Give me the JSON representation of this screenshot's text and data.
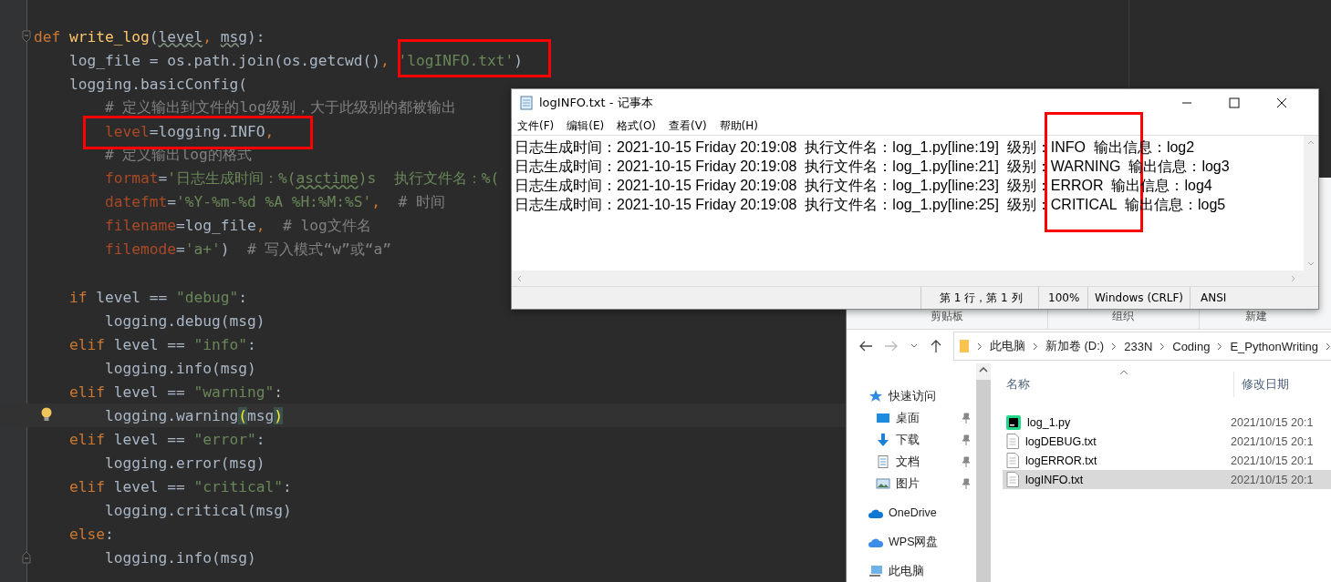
{
  "editor": {
    "lines": [
      {
        "fold_start": true,
        "fold_end": false,
        "current": false,
        "hint": false,
        "spans": [
          {
            "text": "def ",
            "kind": "kw"
          },
          {
            "text": "write_log",
            "kind": "fn"
          },
          {
            "text": "(",
            "kind": "plain"
          },
          {
            "text": "level",
            "kind": "typo"
          },
          {
            "text": ", ",
            "kind": "kw"
          },
          {
            "text": "msg",
            "kind": "typo"
          },
          {
            "text": "):",
            "kind": "plain"
          }
        ]
      },
      {
        "fold_start": false,
        "fold_end": false,
        "current": false,
        "hint": false,
        "spans": [
          {
            "text": "    log_file = os.path.join(os.getcwd()",
            "kind": "plain"
          },
          {
            "text": ", ",
            "kind": "kw"
          },
          {
            "text": "'logINFO.txt'",
            "kind": "str"
          },
          {
            "text": ")",
            "kind": "plain"
          }
        ]
      },
      {
        "fold_start": false,
        "fold_end": false,
        "current": false,
        "hint": false,
        "spans": [
          {
            "text": "    logging.basicConfig(",
            "kind": "plain"
          }
        ]
      },
      {
        "fold_start": false,
        "fold_end": false,
        "current": false,
        "hint": false,
        "spans": [
          {
            "text": "        # 定义输出到文件的log级别，大于此级别的都被输出",
            "kind": "comment"
          }
        ]
      },
      {
        "fold_start": false,
        "fold_end": false,
        "current": false,
        "hint": false,
        "spans": [
          {
            "text": "        level",
            "kind": "param"
          },
          {
            "text": "=logging.INFO",
            "kind": "plain"
          },
          {
            "text": ",",
            "kind": "kw"
          }
        ]
      },
      {
        "fold_start": false,
        "fold_end": false,
        "current": false,
        "hint": false,
        "spans": [
          {
            "text": "        # 定义输出log的格式",
            "kind": "comment"
          }
        ]
      },
      {
        "fold_start": false,
        "fold_end": false,
        "current": false,
        "hint": false,
        "spans": [
          {
            "text": "        format",
            "kind": "param"
          },
          {
            "text": "=",
            "kind": "plain"
          },
          {
            "text": "'日志生成时间：%(",
            "kind": "str"
          },
          {
            "text": "asctime",
            "kind": "strtypo"
          },
          {
            "text": ")s  执行文件名：%(",
            "kind": "str"
          }
        ]
      },
      {
        "fold_start": false,
        "fold_end": false,
        "current": false,
        "hint": false,
        "spans": [
          {
            "text": "        datefmt",
            "kind": "param"
          },
          {
            "text": "=",
            "kind": "plain"
          },
          {
            "text": "'%Y-%m-%d %A %H:%M:%S'",
            "kind": "str"
          },
          {
            "text": ",  ",
            "kind": "kw"
          },
          {
            "text": "# 时间",
            "kind": "comment"
          }
        ]
      },
      {
        "fold_start": false,
        "fold_end": false,
        "current": false,
        "hint": false,
        "spans": [
          {
            "text": "        filename",
            "kind": "param"
          },
          {
            "text": "=log_file",
            "kind": "plain"
          },
          {
            "text": ",  ",
            "kind": "kw"
          },
          {
            "text": "# log文件名",
            "kind": "comment"
          }
        ]
      },
      {
        "fold_start": false,
        "fold_end": false,
        "current": false,
        "hint": false,
        "spans": [
          {
            "text": "        filemode",
            "kind": "param"
          },
          {
            "text": "=",
            "kind": "plain"
          },
          {
            "text": "'a+'",
            "kind": "str"
          },
          {
            "text": ")  ",
            "kind": "plain"
          },
          {
            "text": "# 写入模式“w”或“a”",
            "kind": "comment"
          }
        ]
      },
      {
        "fold_start": false,
        "fold_end": false,
        "current": false,
        "hint": false
      },
      {
        "fold_start": false,
        "fold_end": false,
        "current": false,
        "hint": false,
        "spans": [
          {
            "text": "    if",
            "kind": "kw"
          },
          {
            "text": " level == ",
            "kind": "plain"
          },
          {
            "text": "\"debug\"",
            "kind": "str"
          },
          {
            "text": ":",
            "kind": "plain"
          }
        ]
      },
      {
        "fold_start": false,
        "fold_end": false,
        "current": false,
        "hint": false,
        "spans": [
          {
            "text": "        logging.debug(msg)",
            "kind": "plain"
          }
        ]
      },
      {
        "fold_start": false,
        "fold_end": false,
        "current": false,
        "hint": false,
        "spans": [
          {
            "text": "    elif",
            "kind": "kw"
          },
          {
            "text": " level == ",
            "kind": "plain"
          },
          {
            "text": "\"info\"",
            "kind": "str"
          },
          {
            "text": ":",
            "kind": "plain"
          }
        ]
      },
      {
        "fold_start": false,
        "fold_end": false,
        "current": false,
        "hint": false,
        "spans": [
          {
            "text": "        logging.info(msg)",
            "kind": "plain"
          }
        ]
      },
      {
        "fold_start": false,
        "fold_end": false,
        "current": false,
        "hint": false,
        "spans": [
          {
            "text": "    elif",
            "kind": "kw"
          },
          {
            "text": " level == ",
            "kind": "plain"
          },
          {
            "text": "\"warning\"",
            "kind": "str"
          },
          {
            "text": ":",
            "kind": "plain"
          }
        ]
      },
      {
        "fold_start": false,
        "fold_end": false,
        "current": true,
        "hint": true,
        "spans": [
          {
            "text": "        logging.warning",
            "kind": "plain"
          },
          {
            "text": "(",
            "kind": "match"
          },
          {
            "text": "msg",
            "kind": "plain"
          },
          {
            "text": ")",
            "kind": "match"
          }
        ]
      },
      {
        "fold_start": false,
        "fold_end": false,
        "current": false,
        "hint": false,
        "spans": [
          {
            "text": "    elif",
            "kind": "kw"
          },
          {
            "text": " level == ",
            "kind": "plain"
          },
          {
            "text": "\"error\"",
            "kind": "str"
          },
          {
            "text": ":",
            "kind": "plain"
          }
        ]
      },
      {
        "fold_start": false,
        "fold_end": false,
        "current": false,
        "hint": false,
        "spans": [
          {
            "text": "        logging.error(msg)",
            "kind": "plain"
          }
        ]
      },
      {
        "fold_start": false,
        "fold_end": false,
        "current": false,
        "hint": false,
        "spans": [
          {
            "text": "    elif",
            "kind": "kw"
          },
          {
            "text": " level == ",
            "kind": "plain"
          },
          {
            "text": "\"critical\"",
            "kind": "str"
          },
          {
            "text": ":",
            "kind": "plain"
          }
        ]
      },
      {
        "fold_start": false,
        "fold_end": false,
        "current": false,
        "hint": false,
        "spans": [
          {
            "text": "        logging.critical(msg)",
            "kind": "plain"
          }
        ]
      },
      {
        "fold_start": false,
        "fold_end": false,
        "current": false,
        "hint": false,
        "spans": [
          {
            "text": "    else",
            "kind": "kw"
          },
          {
            "text": ":",
            "kind": "plain"
          }
        ]
      },
      {
        "fold_start": false,
        "fold_end": true,
        "current": false,
        "hint": false,
        "spans": [
          {
            "text": "        logging.info(msg)",
            "kind": "plain"
          }
        ]
      }
    ]
  },
  "notepad": {
    "title": "logINFO.txt - 记事本",
    "menu": [
      "文件(F)",
      "编辑(E)",
      "格式(O)",
      "查看(V)",
      "帮助(H)"
    ],
    "lines": [
      "日志生成时间：2021-10-15 Friday 20:19:08  执行文件名：log_1.py[line:19]  级别：INFO  输出信息：log2",
      "日志生成时间：2021-10-15 Friday 20:19:08  执行文件名：log_1.py[line:21]  级别：WARNING  输出信息：log3",
      "日志生成时间：2021-10-15 Friday 20:19:08  执行文件名：log_1.py[line:23]  级别：ERROR  输出信息：log4",
      "日志生成时间：2021-10-15 Friday 20:19:08  执行文件名：log_1.py[line:25]  级别：CRITICAL  输出信息：log5"
    ],
    "status": [
      "第 1 行，第 1 列",
      "100%",
      "Windows (CRLF)",
      "ANSI"
    ]
  },
  "explorer": {
    "ribbon_groups": [
      "剪贴板",
      "组织",
      "新建"
    ],
    "breadcrumb": [
      "此电脑",
      "新加卷 (D:)",
      "233N",
      "Coding",
      "E_PythonWriting"
    ],
    "sidebar": [
      {
        "label": "快速访问",
        "kind": "star",
        "children": [
          {
            "label": "桌面",
            "kind": "desktop",
            "pinned": true
          },
          {
            "label": "下载",
            "kind": "download",
            "pinned": true
          },
          {
            "label": "文档",
            "kind": "document",
            "pinned": true
          },
          {
            "label": "图片",
            "kind": "image",
            "pinned": true
          }
        ]
      },
      {
        "label": "OneDrive",
        "kind": "cloud"
      },
      {
        "label": "WPS网盘",
        "kind": "cloud2"
      },
      {
        "label": "此电脑",
        "kind": "pc"
      }
    ],
    "columns": [
      "名称",
      "修改日期"
    ],
    "files": [
      {
        "name": "log_1.py",
        "date": "2021/10/15 20:1",
        "kind": "py",
        "selected": false
      },
      {
        "name": "logDEBUG.txt",
        "date": "2021/10/15 20:1",
        "kind": "txt",
        "selected": false
      },
      {
        "name": "logERROR.txt",
        "date": "2021/10/15 20:1",
        "kind": "txt",
        "selected": false
      },
      {
        "name": "logINFO.txt",
        "date": "2021/10/15 20:1",
        "kind": "txt",
        "selected": true
      }
    ]
  }
}
